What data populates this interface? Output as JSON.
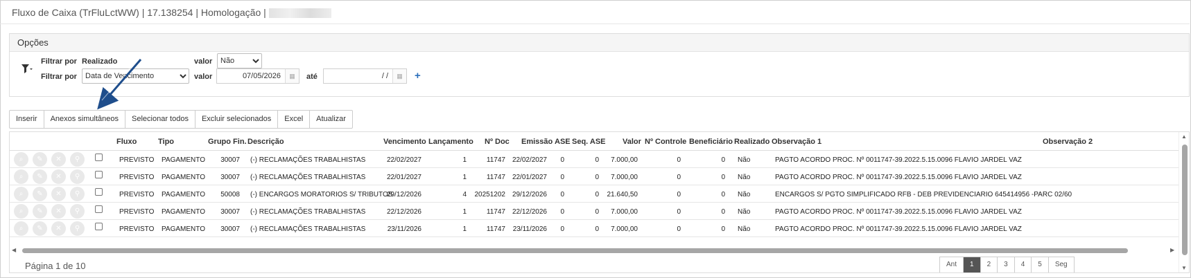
{
  "window": {
    "title": "Fluxo de Caixa (TrFluLctWW) | 17.138254 | Homologação |"
  },
  "options": {
    "header": "Opções",
    "filter1": {
      "label": "Filtrar por",
      "field": "Realizado",
      "value_label": "valor",
      "value": "Não"
    },
    "filter2": {
      "label": "Filtrar por",
      "field": "Data de Vencimento",
      "value_label": "valor",
      "date_from": "07/05/2026",
      "until_label": "até",
      "date_to": " /  /"
    }
  },
  "toolbar": {
    "buttons": [
      "Inserir",
      "Anexos simultâneos",
      "Selecionar todos",
      "Excluir selecionados",
      "Excel",
      "Atualizar"
    ]
  },
  "grid": {
    "columns": [
      "Fluxo",
      "Tipo",
      "Grupo Fin.",
      "Descrição",
      "Vencimento",
      "Lançamento",
      "Nº Doc",
      "Emissão",
      "ASE",
      "Seq. ASE",
      "Valor",
      "Nº Controle",
      "Beneficiário",
      "Realizado",
      "Observação 1",
      "Observação 2"
    ],
    "rows": [
      [
        "PREVISTO",
        "PAGAMENTO",
        "30007",
        "(-) RECLAMAÇÕES TRABALHISTAS",
        "22/02/2027",
        "1",
        "11747",
        "22/02/2027",
        "0",
        "0",
        "7.000,00",
        "0",
        "0",
        "Não",
        "PAGTO ACORDO PROC. Nº 0011747-39.2022.5.15.0096 FLAVIO JARDEL VAZ"
      ],
      [
        "PREVISTO",
        "PAGAMENTO",
        "30007",
        "(-) RECLAMAÇÕES TRABALHISTAS",
        "22/01/2027",
        "1",
        "11747",
        "22/01/2027",
        "0",
        "0",
        "7.000,00",
        "0",
        "0",
        "Não",
        "PAGTO ACORDO PROC. Nº 0011747-39.2022.5.15.0096 FLAVIO JARDEL VAZ"
      ],
      [
        "PREVISTO",
        "PAGAMENTO",
        "50008",
        "(-) ENCARGOS MORATORIOS S/ TRIBUTOS",
        "29/12/2026",
        "4",
        "20251202",
        "29/12/2026",
        "0",
        "0",
        "21.640,50",
        "0",
        "0",
        "Não",
        "ENCARGOS S/ PGTO SIMPLIFICADO RFB - DEB PREVIDENCIARIO 645414956 -PARC 02/60"
      ],
      [
        "PREVISTO",
        "PAGAMENTO",
        "30007",
        "(-) RECLAMAÇÕES TRABALHISTAS",
        "22/12/2026",
        "1",
        "11747",
        "22/12/2026",
        "0",
        "0",
        "7.000,00",
        "0",
        "0",
        "Não",
        "PAGTO ACORDO PROC. Nº 0011747-39.2022.5.15.0096 FLAVIO JARDEL VAZ"
      ],
      [
        "PREVISTO",
        "PAGAMENTO",
        "30007",
        "(-) RECLAMAÇÕES TRABALHISTAS",
        "23/11/2026",
        "1",
        "11747",
        "23/11/2026",
        "0",
        "0",
        "7.000,00",
        "0",
        "0",
        "Não",
        "PAGTO ACORDO PROC. Nº 0011747-39.2022.5.15.0096 FLAVIO JARDEL VAZ"
      ]
    ]
  },
  "pager": {
    "text": "Página 1 de 10",
    "buttons": [
      "Ant",
      "1",
      "2",
      "3",
      "4",
      "5",
      "Seg"
    ],
    "active": "1"
  },
  "colors": {
    "accent": "#2a6ebb",
    "arrow": "#1f4e8c",
    "active_page": "#555555"
  }
}
